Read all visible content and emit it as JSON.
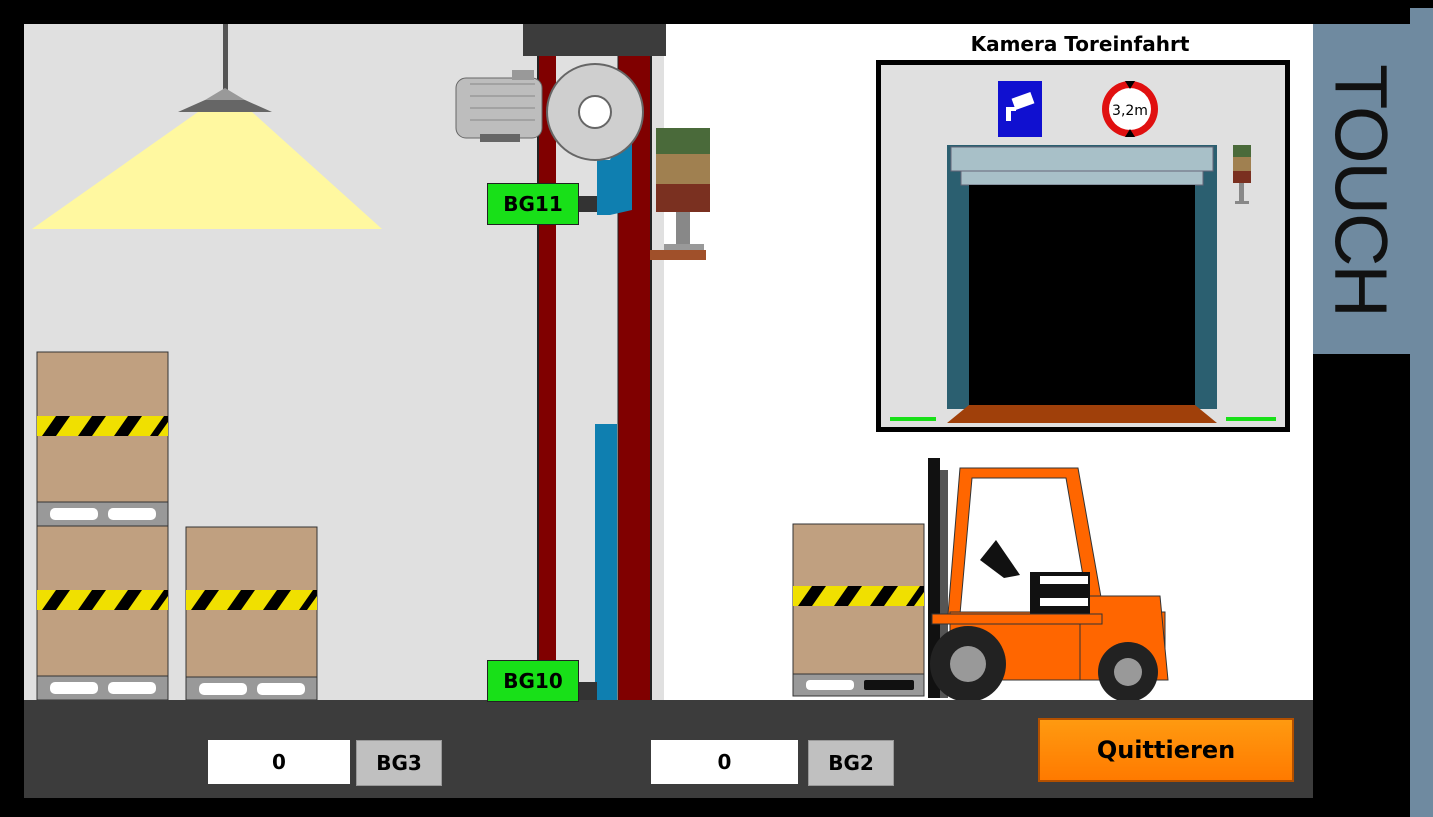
{
  "scene": {
    "sensors": {
      "upper_lift": "BG11",
      "lower_lift": "BG10",
      "floor_left": "BG3",
      "floor_right": "BG2"
    },
    "counters": {
      "left": "0",
      "right": "0"
    }
  },
  "camera": {
    "title": "Kamera Toreinfahrt",
    "height_limit_sign": "3,2m"
  },
  "actions": {
    "acknowledge_label": "Quittieren"
  },
  "side_panel": {
    "label": "TOUCH"
  },
  "colors": {
    "sensor_active": "#18e018",
    "lift_frame": "#800000",
    "button": "#ff8c00",
    "panel": "#6f8aa0"
  }
}
